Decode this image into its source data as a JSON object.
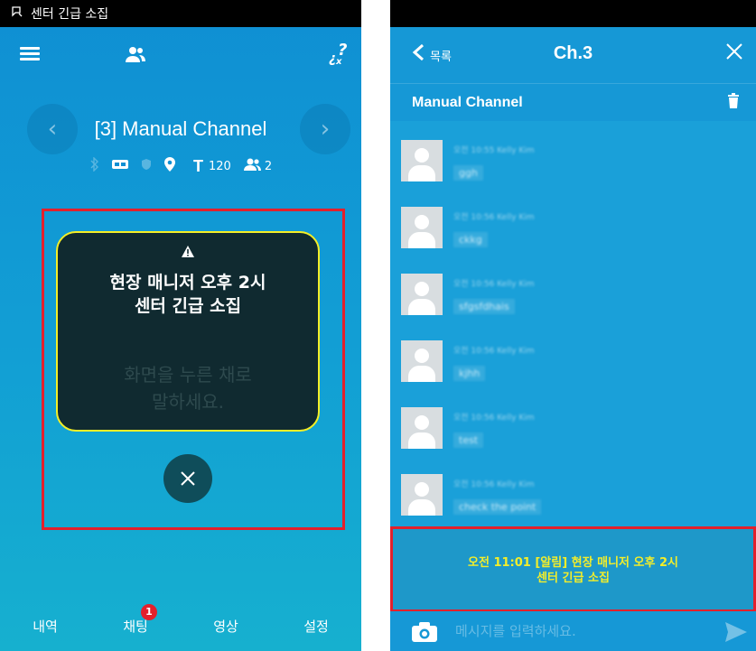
{
  "left_screen": {
    "status": {
      "notification_text": "센터 긴급 소집"
    },
    "topbar": {
      "menu_icon": "menu-icon",
      "users_icon": "users-icon",
      "help_icon": "help-icon"
    },
    "channel": {
      "title": "[3] Manual Channel",
      "text_count": "120",
      "member_count": "2",
      "t_label": "T"
    },
    "alert": {
      "message_line1": "현장 매니저 오후 2시",
      "message_line2": "센터 긴급 소집",
      "hint_line1": "화면을 누른 채로",
      "hint_line2": "말하세요."
    },
    "bottom_nav": [
      {
        "label": "내역"
      },
      {
        "label": "채팅",
        "badge": "1"
      },
      {
        "label": "영상"
      },
      {
        "label": "설정"
      }
    ]
  },
  "right_screen": {
    "header": {
      "back_label": "목록",
      "title": "Ch.3"
    },
    "channel_name": "Manual Channel",
    "messages": [
      {
        "meta": "오전 10:55 Kelly Kim",
        "text": "ggh"
      },
      {
        "meta": "오전 10:56 Kelly Kim",
        "text": "ckkg"
      },
      {
        "meta": "오전 10:56 Kelly Kim",
        "text": "sfgsfdhais"
      },
      {
        "meta": "오전 10:56 Kelly Kim",
        "text": "kjhh"
      },
      {
        "meta": "오전 10:56 Kelly Kim",
        "text": "test"
      },
      {
        "meta": "오전 10:56 Kelly Kim",
        "text": "check the point"
      }
    ],
    "alert_banner": {
      "line1": "오전 11:01 [알림] 현장 매니저 오후 2시",
      "line2": "센터 긴급 소집"
    },
    "input": {
      "placeholder": "메시지를 입력하세요."
    }
  },
  "colors": {
    "highlight_border": "#e3202c",
    "alert_yellow": "#f3ee2a",
    "badge_red": "#e3202c"
  }
}
